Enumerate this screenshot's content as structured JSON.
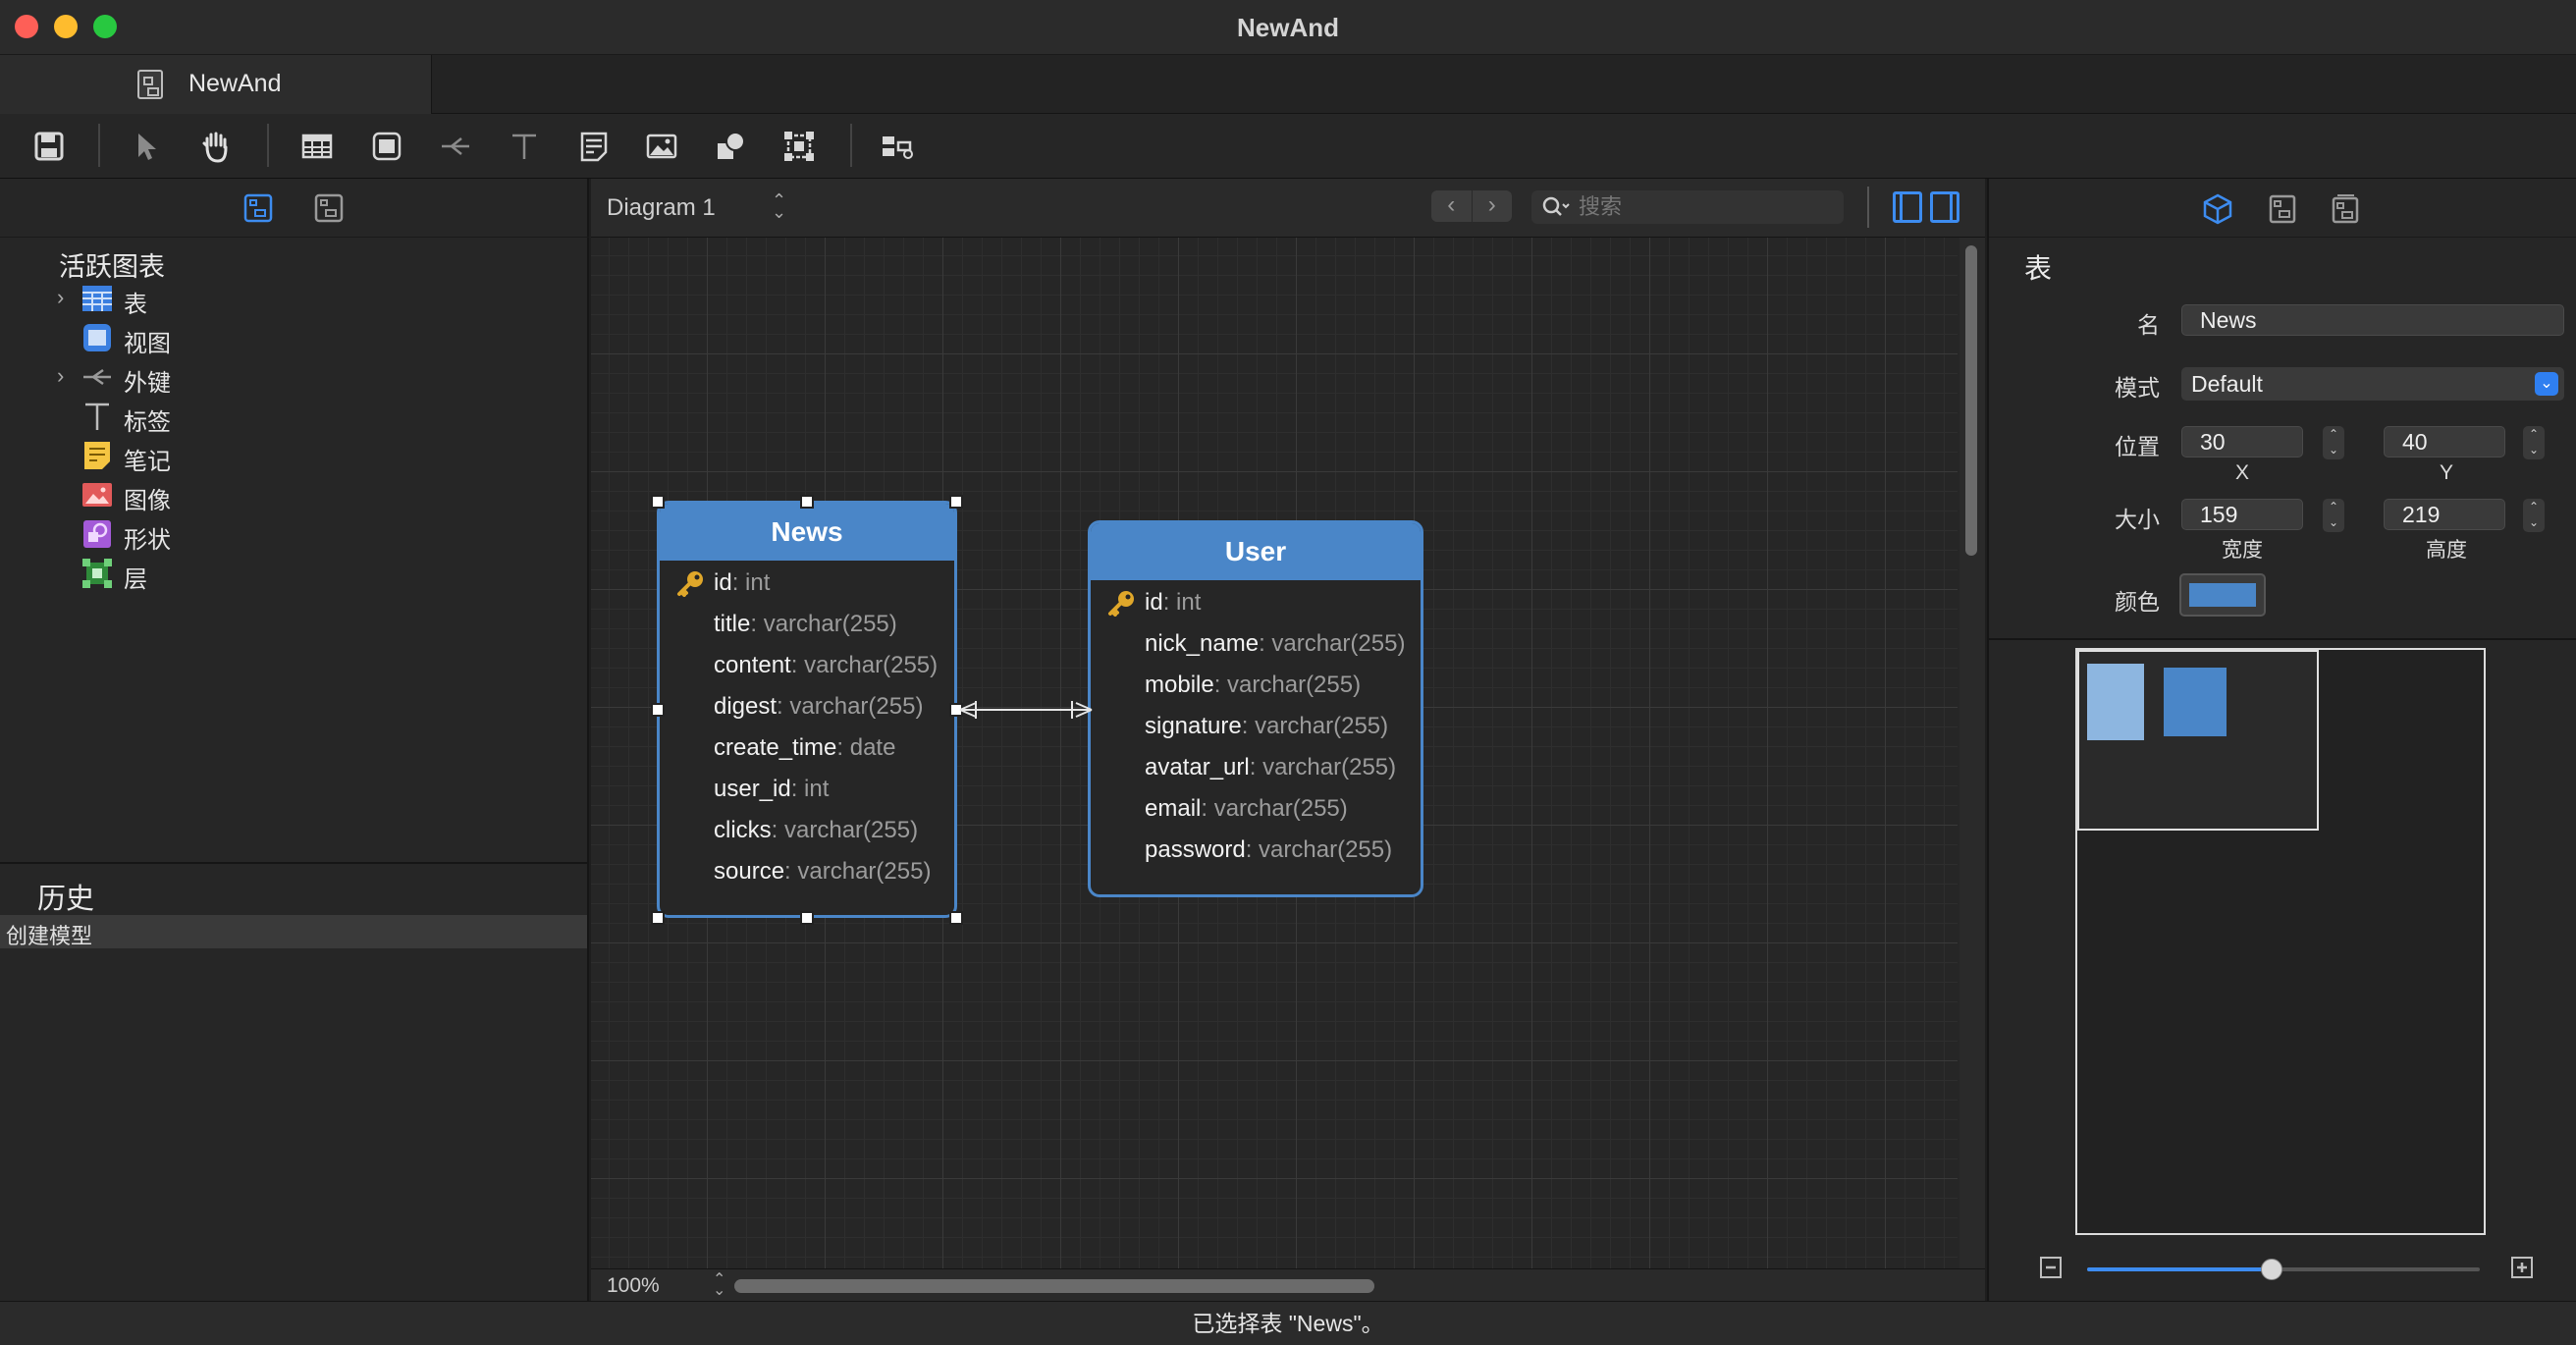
{
  "window": {
    "title": "NewAnd"
  },
  "tab": {
    "label": "NewAnd"
  },
  "toolbar": {
    "tools": [
      "save-icon",
      "pointer-icon",
      "hand-icon",
      "table-icon",
      "view-icon",
      "foreign-key-icon",
      "label-icon",
      "note-icon",
      "image-icon",
      "shape-icon",
      "layer-icon",
      "arrange-icon"
    ]
  },
  "left_panel": {
    "tree_title": "活跃图表",
    "items": [
      {
        "label": "表",
        "icon": "table-icon",
        "expandable": true
      },
      {
        "label": "视图",
        "icon": "view-icon",
        "expandable": false
      },
      {
        "label": "外键",
        "icon": "foreign-key-icon",
        "expandable": true
      },
      {
        "label": "标签",
        "icon": "label-icon",
        "expandable": false
      },
      {
        "label": "笔记",
        "icon": "note-icon",
        "expandable": false
      },
      {
        "label": "图像",
        "icon": "image-icon",
        "expandable": false
      },
      {
        "label": "形状",
        "icon": "shape-icon",
        "expandable": false
      },
      {
        "label": "层",
        "icon": "layer-icon",
        "expandable": false
      }
    ],
    "history_title": "历史",
    "history_items": [
      "创建模型"
    ]
  },
  "canvas": {
    "diagram_name": "Diagram 1",
    "search_placeholder": "搜索",
    "zoom": "100%"
  },
  "entities": {
    "news": {
      "name": "News",
      "fields": [
        {
          "name": "id",
          "type": ": int",
          "key": true
        },
        {
          "name": "title",
          "type": ": varchar(255)"
        },
        {
          "name": "content",
          "type": ": varchar(255)"
        },
        {
          "name": "digest",
          "type": ": varchar(255)"
        },
        {
          "name": "create_time",
          "type": ": date"
        },
        {
          "name": "user_id",
          "type": ": int"
        },
        {
          "name": "clicks",
          "type": ": varchar(255)"
        },
        {
          "name": "source",
          "type": ": varchar(255)"
        }
      ]
    },
    "user": {
      "name": "User",
      "fields": [
        {
          "name": "id",
          "type": ": int",
          "key": true
        },
        {
          "name": "nick_name",
          "type": ": varchar(255)"
        },
        {
          "name": "mobile",
          "type": ": varchar(255)"
        },
        {
          "name": "signature",
          "type": ": varchar(255)"
        },
        {
          "name": "avatar_url",
          "type": ": varchar(255)"
        },
        {
          "name": "email",
          "type": ": varchar(255)"
        },
        {
          "name": "password",
          "type": ": varchar(255)"
        }
      ]
    }
  },
  "inspector": {
    "title": "表",
    "name_label": "名",
    "name_value": "News",
    "schema_label": "模式",
    "schema_value": "Default",
    "position_label": "位置",
    "x_value": "30",
    "y_value": "40",
    "x_label": "X",
    "y_label": "Y",
    "size_label": "大小",
    "width_value": "159",
    "height_value": "219",
    "width_label": "宽度",
    "height_label": "高度",
    "color_label": "颜色",
    "color_value": "#4a86c8"
  },
  "zoom_slider": {
    "value": 0.47
  },
  "status": {
    "text": "已选择表 \"News\"。"
  },
  "colors": {
    "accent": "#3d8cf0",
    "entity": "#4a86c8",
    "entity_light": "#8db6e0"
  }
}
